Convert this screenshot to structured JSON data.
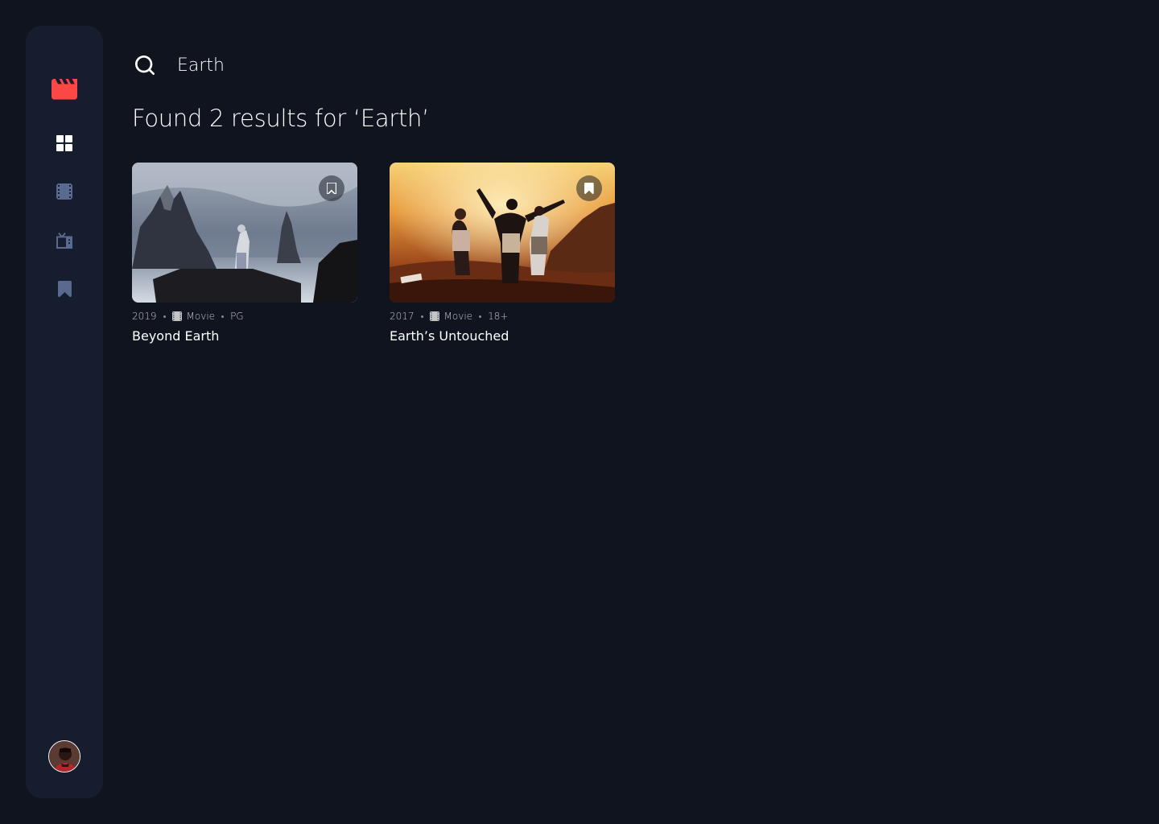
{
  "colors": {
    "background": "#10141E",
    "sidebar": "#161D2F",
    "accent": "#FC4747",
    "nav_inactive": "#5A698F",
    "nav_active": "#FFFFFF"
  },
  "sidebar": {
    "logo_icon": "movie-clapper-icon",
    "nav": [
      {
        "name": "home",
        "icon": "grid-icon",
        "active": true
      },
      {
        "name": "movies",
        "icon": "film-icon",
        "active": false
      },
      {
        "name": "tv-series",
        "icon": "tv-icon",
        "active": false
      },
      {
        "name": "bookmarked",
        "icon": "bookmark-icon",
        "active": false
      }
    ],
    "avatar": "user-avatar"
  },
  "search": {
    "value": "Earth",
    "icon": "search-icon"
  },
  "results_heading": "Found 2 results for ‘Earth’",
  "results": [
    {
      "year": "2019",
      "category": "Movie",
      "rating": "PG",
      "title": "Beyond Earth",
      "bookmarked": false
    },
    {
      "year": "2017",
      "category": "Movie",
      "rating": "18+",
      "title": "Earth’s Untouched",
      "bookmarked": true
    }
  ]
}
